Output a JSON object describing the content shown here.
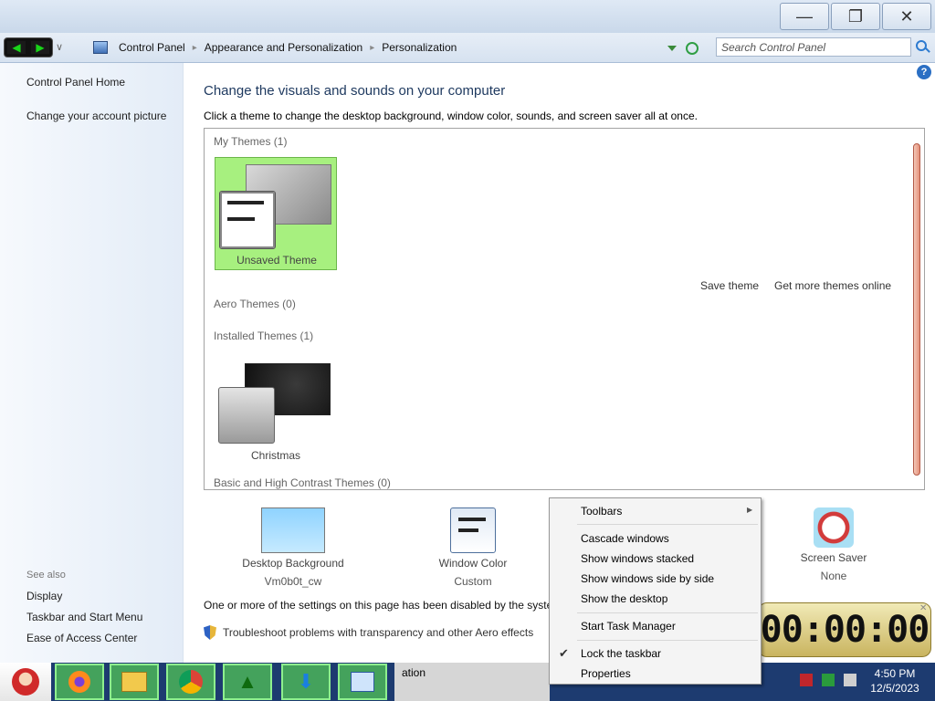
{
  "address": {
    "crumbs": [
      "Control Panel",
      "Appearance and Personalization",
      "Personalization"
    ],
    "search_placeholder": "Search Control Panel"
  },
  "left_pane": {
    "links": [
      "Control Panel Home",
      "Change your account picture"
    ],
    "see_also_title": "See also",
    "see_also": [
      "Display",
      "Taskbar and Start Menu",
      "Ease of Access Center"
    ]
  },
  "main": {
    "heading": "Change the visuals and sounds on your computer",
    "subheading": "Click a theme to change the desktop background, window color, sounds, and screen saver all at once.",
    "groups": {
      "my_themes": "My Themes (1)",
      "aero_themes": "Aero Themes (0)",
      "installed_themes": "Installed Themes (1)",
      "basic_themes": "Basic and High Contrast Themes (0)"
    },
    "themes": {
      "unsaved": "Unsaved Theme",
      "christmas": "Christmas"
    },
    "save_theme": "Save theme",
    "get_more": "Get more themes online",
    "settings": {
      "desktop_bg_label": "Desktop Background",
      "desktop_bg_value": "Vm0b0t_cw",
      "window_color_label": "Window Color",
      "window_color_value": "Custom",
      "screen_saver_label": "Screen Saver",
      "screen_saver_value": "None"
    },
    "disabled_msg": "One or more of the settings on this page has been disabled by the system",
    "troubleshoot": "Troubleshoot problems with transparency and other Aero effects"
  },
  "clock": {
    "display": "00:00:00"
  },
  "context_menu": {
    "toolbars": "Toolbars",
    "cascade": "Cascade windows",
    "stacked": "Show windows stacked",
    "side_by_side": "Show windows side by side",
    "show_desktop": "Show the desktop",
    "task_manager": "Start Task Manager",
    "lock": "Lock the taskbar",
    "properties": "Properties"
  },
  "taskbar": {
    "task_label": "ation",
    "time": "4:50 PM",
    "date": "12/5/2023"
  },
  "colors": {
    "theme_highlight": "#a7f07f",
    "taskbar_button": "#44a25c",
    "scrollbar": "#e6927b"
  }
}
